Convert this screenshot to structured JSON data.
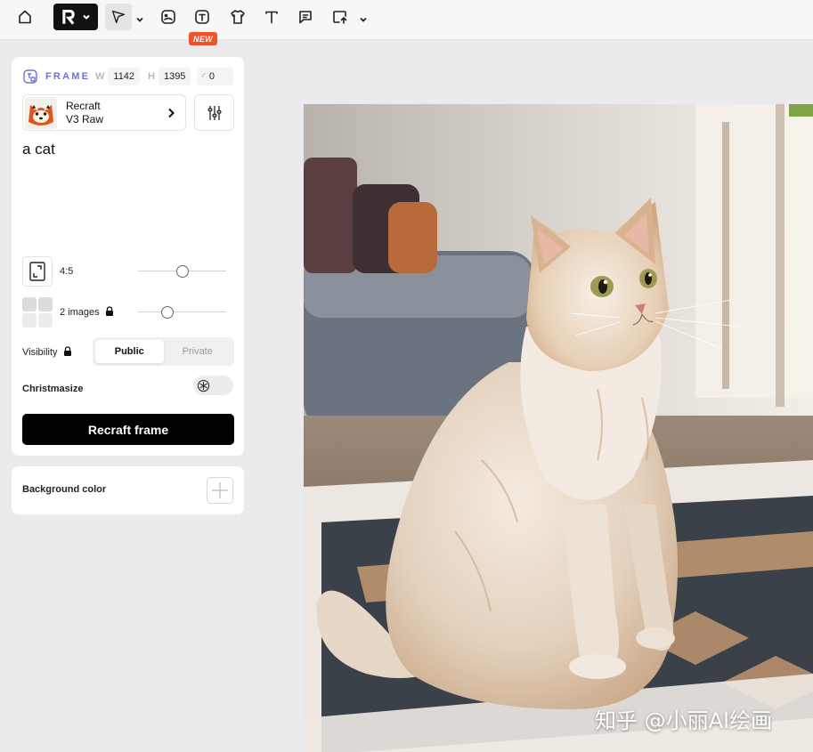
{
  "toolbar": {
    "items": [
      {
        "name": "home-icon"
      },
      {
        "name": "brand-logo"
      },
      {
        "name": "select-tool-icon"
      },
      {
        "name": "image-tool-icon"
      },
      {
        "name": "frame-tool-icon"
      },
      {
        "name": "mockup-tool-icon"
      },
      {
        "name": "text-tool-icon"
      },
      {
        "name": "comment-tool-icon"
      },
      {
        "name": "upload-tool-icon"
      }
    ],
    "new_badge": "NEW"
  },
  "frame_panel": {
    "title": "FRAME",
    "width_label": "W",
    "width_value": "1142",
    "height_label": "H",
    "height_value": "1395",
    "rotation_value": "0",
    "model_line1": "Recraft",
    "model_line2": "V3 Raw",
    "prompt": "a cat",
    "aspect_ratio": "4:5",
    "aspect_slider_fraction": 0.5,
    "images_label": "2 images",
    "images_slider_fraction": 0.3,
    "visibility_label": "Visibility",
    "visibility_options": [
      "Public",
      "Private"
    ],
    "visibility_selected": "Public",
    "christmasize_label": "Christmasize",
    "christmasize_on": false,
    "action_button": "Recraft frame"
  },
  "background_panel": {
    "label": "Background color"
  },
  "canvas": {
    "image_subject": "cat",
    "watermark": "知乎 @小丽AI绘画"
  },
  "colors": {
    "accent": "#6b72d8",
    "badge": "#f0532a",
    "button": "#000000"
  }
}
